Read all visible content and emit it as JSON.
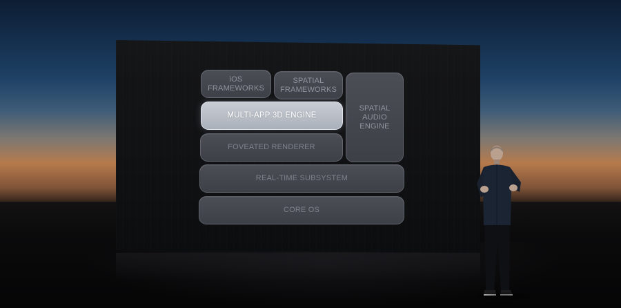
{
  "diagram": {
    "blocks": [
      {
        "id": "ios",
        "lines": [
          "iOS",
          "FRAMEWORKS"
        ]
      },
      {
        "id": "spatial-frameworks",
        "lines": [
          "SPATIAL",
          "FRAMEWORKS"
        ]
      },
      {
        "id": "spatial-audio",
        "lines": [
          "SPATIAL",
          "AUDIO",
          "ENGINE"
        ]
      },
      {
        "id": "multi-app",
        "lines": [
          "MULTI-APP 3D ENGINE"
        ],
        "highlighted": true
      },
      {
        "id": "foveated",
        "lines": [
          "FOVEATED RENDERER"
        ]
      },
      {
        "id": "realtime",
        "lines": [
          "REAL-TIME SUBSYSTEM"
        ]
      },
      {
        "id": "core-os",
        "lines": [
          "CORE OS"
        ]
      }
    ]
  },
  "colors": {
    "tile": "#44474e",
    "tile_text": "#8f949c",
    "highlight_tile": "#bcc1ca",
    "highlight_text": "#ffffff",
    "sky_top": "#0d1d33",
    "sunset": "#b67a4c"
  }
}
